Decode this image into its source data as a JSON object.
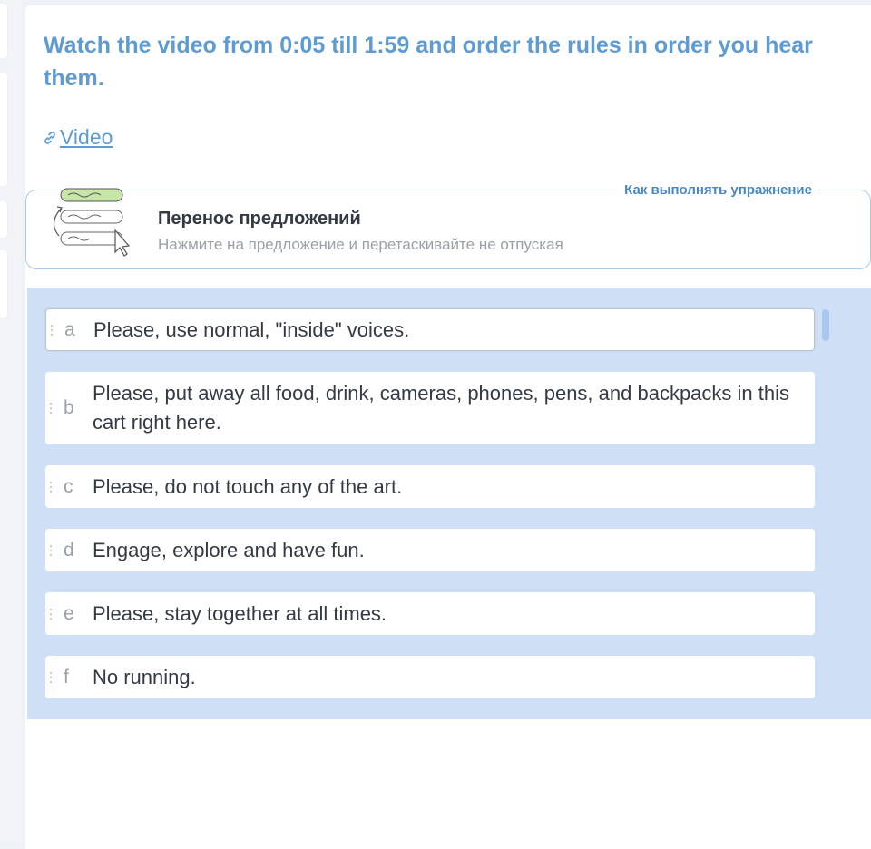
{
  "instruction": "Watch the video from 0:05 till 1:59 and order the rules in order you hear them.",
  "video_link": {
    "label": "Video",
    "icon": "link-icon"
  },
  "howto": {
    "legend": "Как выполнять упражнение",
    "title": "Перенос предложений",
    "subtitle": "Нажмите на предложение и перетаскивайте не отпуская",
    "icon": "drag-sentences-illustration"
  },
  "items": [
    {
      "letter": "a",
      "text": "Please, use normal, \"inside\" voices."
    },
    {
      "letter": "b",
      "text": "Please, put away all food, drink, cameras, phones, pens, and backpacks in this cart right here."
    },
    {
      "letter": "c",
      "text": "Please, do not touch any of the art."
    },
    {
      "letter": "d",
      "text": "Engage, explore and have fun."
    },
    {
      "letter": "e",
      "text": "Please, stay together at all times."
    },
    {
      "letter": "f",
      "text": "No running."
    }
  ],
  "colors": {
    "accent": "#5e9bd2",
    "sort_area_bg": "#cfe0f6",
    "text": "#333a44",
    "muted": "#9aa0a8"
  }
}
